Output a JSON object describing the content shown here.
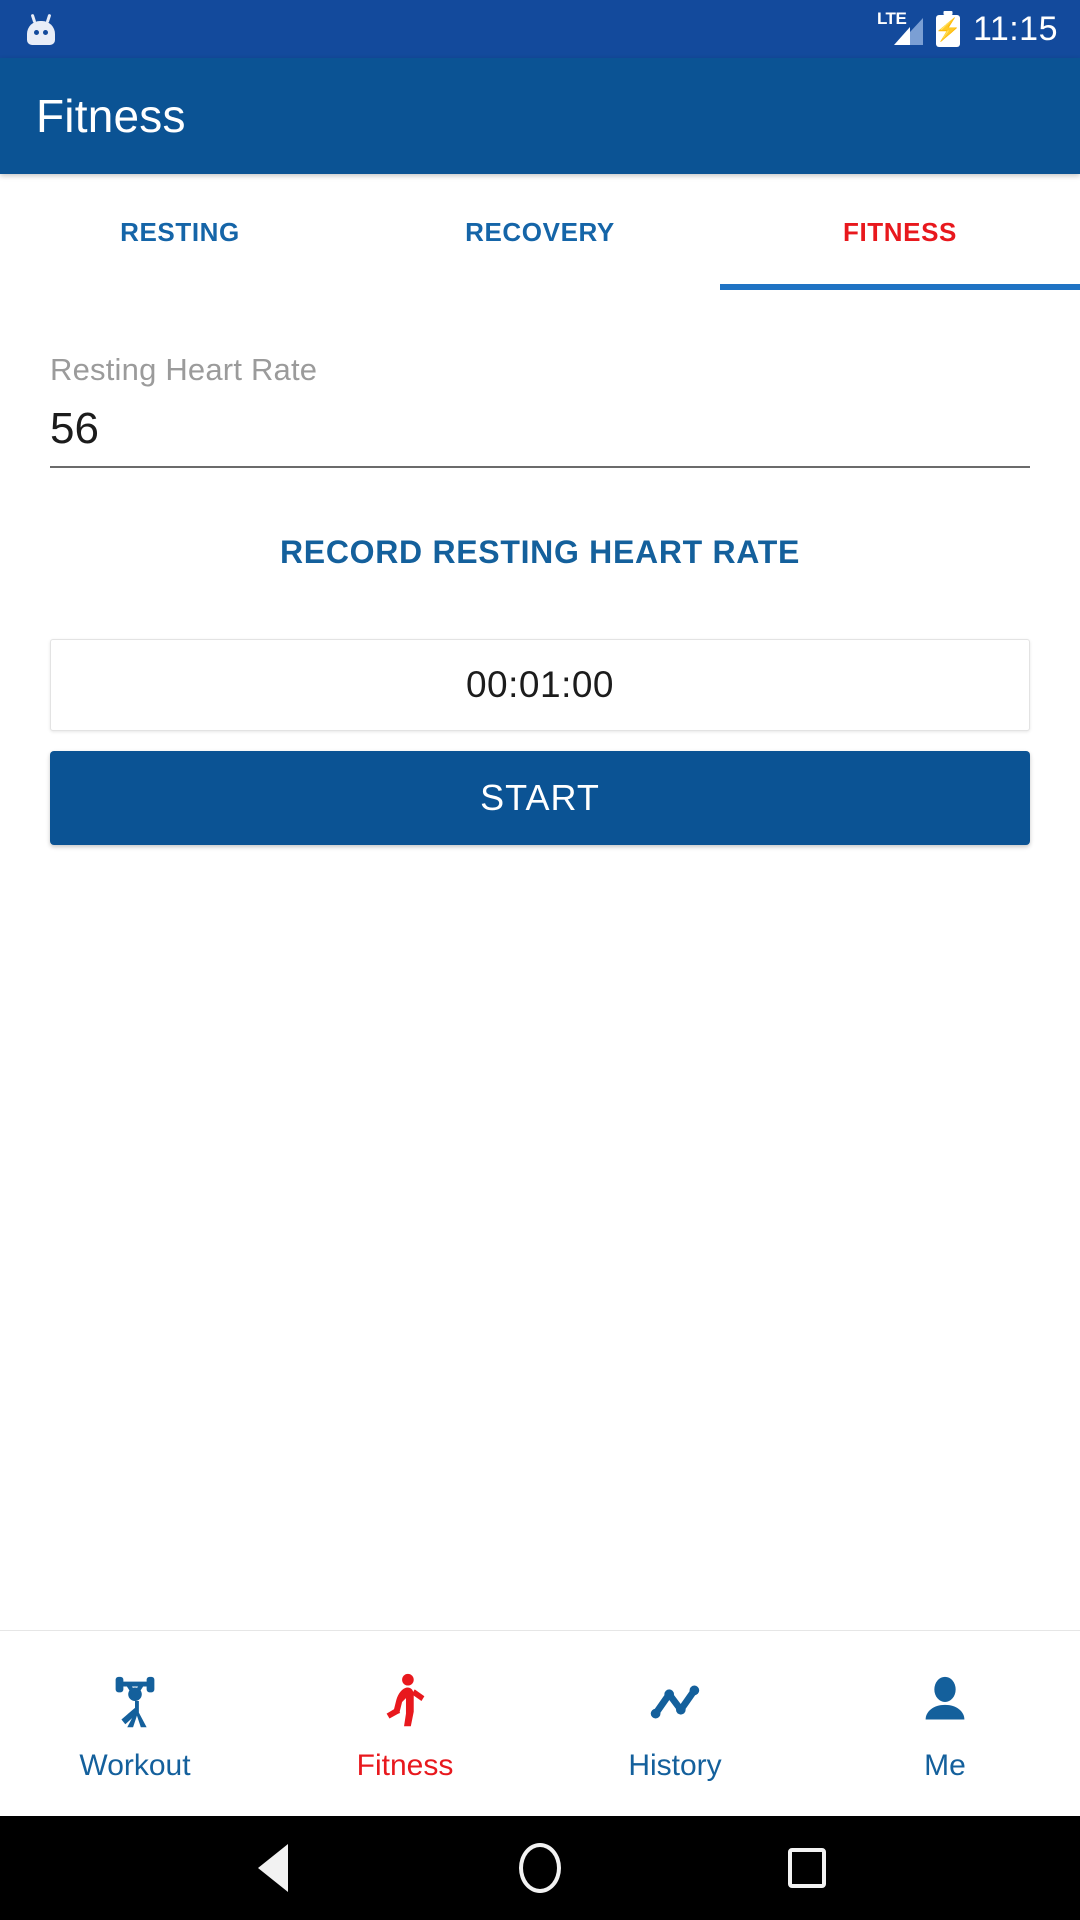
{
  "status_bar": {
    "notification_icon": "android-head-icon",
    "network_label": "LTE",
    "signal_icon": "signal-bars-icon",
    "battery_icon": "battery-charging-icon",
    "time": "11:15"
  },
  "app_bar": {
    "title": "Fitness"
  },
  "tabs": [
    {
      "label": "RESTING",
      "active": false
    },
    {
      "label": "RECOVERY",
      "active": false
    },
    {
      "label": "FITNESS",
      "active": true
    }
  ],
  "form": {
    "resting_heart_rate_label": "Resting Heart Rate",
    "resting_heart_rate_value": "56",
    "resting_heart_rate_placeholder": "Resting Heart Rate"
  },
  "actions": {
    "record_label": "RECORD RESTING HEART RATE",
    "timer_value": "00:01:00",
    "start_label": "START"
  },
  "bottom_nav": [
    {
      "label": "Workout",
      "icon": "weightlifter-icon",
      "active": false
    },
    {
      "label": "Fitness",
      "icon": "runner-icon",
      "active": true
    },
    {
      "label": "History",
      "icon": "line-chart-icon",
      "active": false
    },
    {
      "label": "Me",
      "icon": "person-icon",
      "active": false
    }
  ],
  "system_nav": {
    "back": "back-triangle-icon",
    "home": "home-circle-icon",
    "recents": "recents-square-icon"
  },
  "colors": {
    "status_bar": "#134a9c",
    "app_bar": "#0b5394",
    "accent_blue": "#14609c",
    "active_red": "#e8181d",
    "indicator_blue": "#1f73c4"
  }
}
